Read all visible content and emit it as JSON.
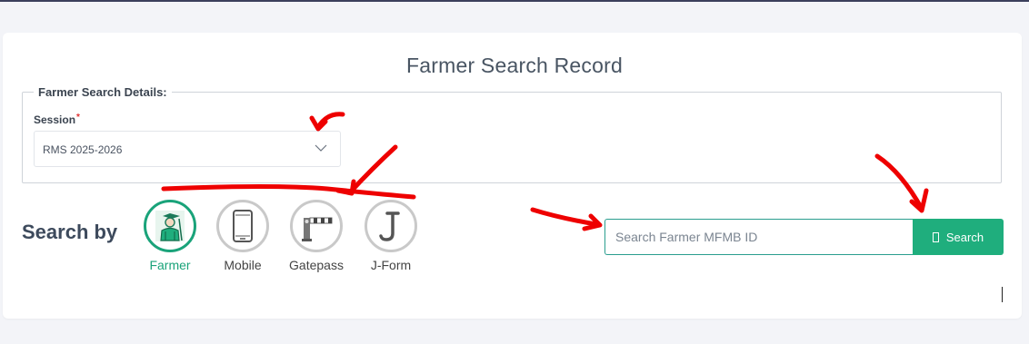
{
  "page": {
    "title": "Farmer Search Record"
  },
  "details": {
    "legend": "Farmer Search Details:",
    "session_label": "Session",
    "required_mark": "*",
    "session_value": "RMS 2025-2026"
  },
  "search_by": {
    "label": "Search by",
    "options": [
      {
        "label": "Farmer",
        "icon": "farmer-icon",
        "active": true
      },
      {
        "label": "Mobile",
        "icon": "mobile-icon",
        "active": false
      },
      {
        "label": "Gatepass",
        "icon": "gatepass-barrier-icon",
        "active": false
      },
      {
        "label": "J-Form",
        "icon": "j-form-icon",
        "active": false
      }
    ]
  },
  "search": {
    "placeholder": "Search Farmer MFMB ID",
    "button_label": "Search"
  },
  "colors": {
    "accent": "#1fae7d",
    "active_text": "#1aa37a",
    "annotation": "#ee0000"
  }
}
